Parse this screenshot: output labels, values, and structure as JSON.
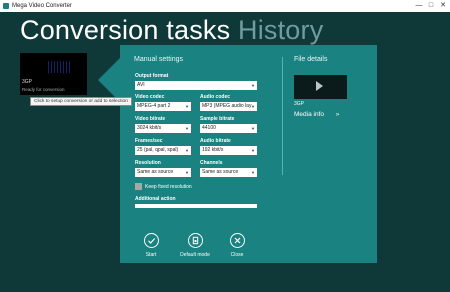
{
  "window": {
    "title": "Mega Video Converter",
    "controls": {
      "minimize": "—",
      "maximize": "□",
      "close": "✕"
    }
  },
  "header": {
    "active_tab": "Conversion tasks",
    "inactive_tab": "History"
  },
  "task": {
    "format": "3GP",
    "status": "Ready for conversion",
    "tooltip": "Click to setup conversion or add to selection"
  },
  "settings": {
    "title": "Manual settings",
    "output_format": {
      "label": "Output format",
      "value": "AVI"
    },
    "video_codec": {
      "label": "Video codec",
      "value": "MPEG-4 part 2"
    },
    "audio_codec": {
      "label": "Audio codec",
      "value": "MP3 (MPEG audio lay"
    },
    "video_bitrate": {
      "label": "Video bitrate",
      "value": "3024 kbit/s"
    },
    "sample_bitrate": {
      "label": "Sample bitrate",
      "value": "44100"
    },
    "frames": {
      "label": "Frames/sec",
      "value": "25 (pal, qpal, spal)"
    },
    "audio_bitrate": {
      "label": "Audio bitrate",
      "value": "192 kbit/s"
    },
    "resolution": {
      "label": "Resolution",
      "value": "Same as source"
    },
    "channels": {
      "label": "Channels",
      "value": "Same as source"
    },
    "keep_resolution": {
      "label": "Keep fixed resolution",
      "checked": false
    },
    "additional_action": {
      "label": "Additional action",
      "progress": 1.0
    }
  },
  "file_details": {
    "title": "File details",
    "format": "3GP",
    "media_info": "Media info",
    "chevron": "»"
  },
  "actions": {
    "start": {
      "label": "Start",
      "icon": "check-icon"
    },
    "default_mode": {
      "label": "Default mode",
      "icon": "default-mode-icon"
    },
    "close": {
      "label": "Close",
      "icon": "close-icon"
    }
  },
  "colors": {
    "background": "#0f3838",
    "panel": "#1a8280",
    "muted_tab": "#6f9c9c"
  }
}
